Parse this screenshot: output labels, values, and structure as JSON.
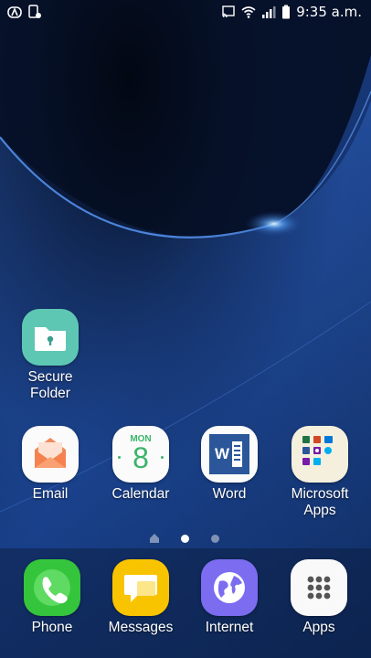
{
  "status_bar": {
    "time": "9:35 a.m.",
    "left_icons": [
      "android-auto-icon",
      "screen-record-icon"
    ],
    "right_icons": [
      "cast-icon",
      "wifi-icon",
      "signal-icon",
      "battery-icon"
    ]
  },
  "home": {
    "folder_app": {
      "label": "Secure\nFolder"
    },
    "row_apps": [
      {
        "label": "Email"
      },
      {
        "label": "Calendar",
        "calendar_day": "MON",
        "calendar_date": "8"
      },
      {
        "label": "Word",
        "word_letter": "W"
      },
      {
        "label": "Microsoft\nApps"
      }
    ],
    "pages": {
      "count": 2,
      "active": 1
    }
  },
  "dock": [
    {
      "label": "Phone"
    },
    {
      "label": "Messages"
    },
    {
      "label": "Internet"
    },
    {
      "label": "Apps"
    }
  ],
  "colors": {
    "secure_folder": "#5ec7b4",
    "email": "#f5824e",
    "calendar_green": "#3bb46a",
    "word_blue": "#2b579a",
    "phone_green": "#35c53c",
    "messages_yellow": "#f8c400",
    "internet_purple": "#7b6cf0"
  }
}
